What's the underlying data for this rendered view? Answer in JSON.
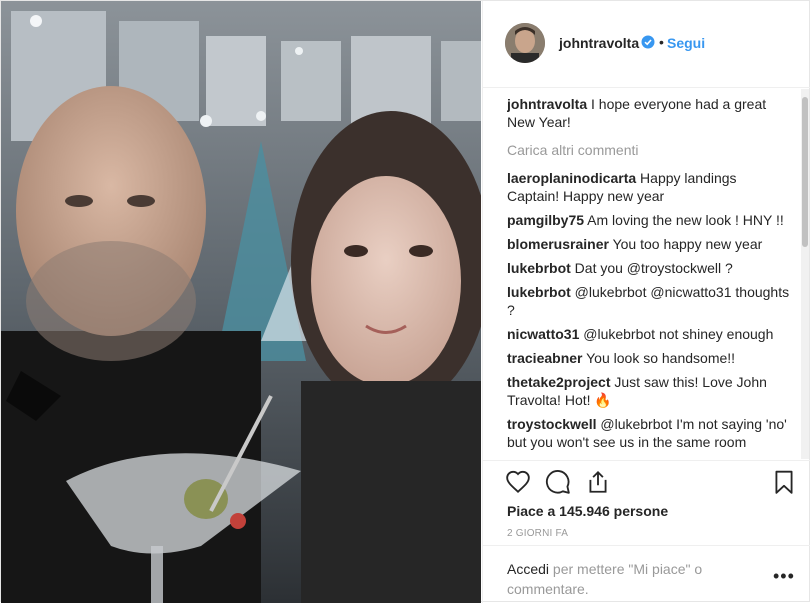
{
  "header": {
    "username": "johntravolta",
    "separator": "•",
    "follow_label": "Segui"
  },
  "caption": {
    "username": "johntravolta",
    "text": "I hope everyone had a great New Year!"
  },
  "load_more_label": "Carica altri commenti",
  "comments": [
    {
      "user": "laeroplaninodicarta",
      "text": "Happy landings Captain! Happy new year"
    },
    {
      "user": "pamgilby75",
      "text": "Am loving the new look ! HNY !!"
    },
    {
      "user": "blomerusrainer",
      "text": "You too happy new year"
    },
    {
      "user": "lukebrbot",
      "text": "Dat you @troystockwell ?"
    },
    {
      "user": "lukebrbot",
      "text": "@lukebrbot @nicwatto31 thoughts ?"
    },
    {
      "user": "nicwatto31",
      "text": "@lukebrbot not shiney enough"
    },
    {
      "user": "tracieabner",
      "text": "You look so handsome!!"
    },
    {
      "user": "thetake2project",
      "text": "Just saw this! Love John Travolta! Hot! 🔥"
    },
    {
      "user": "troystockwell",
      "text": "@lukebrbot I'm not saying 'no' but you won't see us in the same room"
    }
  ],
  "likes": "Piace a 145.946 persone",
  "timestamp": "2 GIORNI FA",
  "login": {
    "link": "Accedi",
    "text": " per mettere \"Mi piace\" o commentare."
  },
  "more_options": "•••",
  "icons": {
    "like": "heart-icon",
    "comment": "comment-icon",
    "share": "share-icon",
    "save": "bookmark-icon",
    "verified": "verified-badge-icon"
  },
  "colors": {
    "accent": "#3897f0",
    "muted": "#999999",
    "text": "#262626"
  }
}
